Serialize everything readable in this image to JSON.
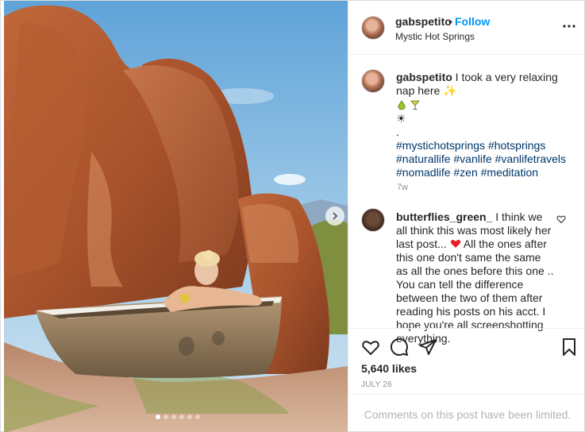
{
  "post": {
    "username": "gabspetito",
    "bullet": "•",
    "follow_label": "Follow",
    "location": "Mystic Hot Springs",
    "more_icon": "more-options-icon"
  },
  "photo": {
    "carousel_total": 6,
    "carousel_active": 1,
    "next_icon": "chevron-right-icon"
  },
  "caption": {
    "username": "gabspetito",
    "text": "I took a very relaxing nap here",
    "sparkle": "✨",
    "sun": "☀",
    "dot": ".",
    "hashtags_line1": "#mysticho tsprings #hotsprings",
    "hashtags": [
      "#mystichotsprings",
      "#hotsprings",
      "#naturallife",
      "#vanlife",
      "#vanlifetravels",
      "#nomadlife",
      "#zen",
      "#meditation"
    ],
    "time": "7w"
  },
  "comment": {
    "username": "butterflies_green_",
    "text_before_heart": "I think we all think this was most likely her last post...",
    "text_after_heart": "All the ones after this one don't same the same as all the ones before this one .. You can tell the difference between the two of them after reading his posts on his acct. I hope you're all screenshotting everything."
  },
  "actions": {
    "likes": "5,640 likes",
    "date": "JULY 26",
    "limited": "Comments on this post have been limited."
  },
  "colors": {
    "accent": "#0095f6",
    "hashtag": "#00376b",
    "muted": "#8e8e8e",
    "heart_red": "#ed1c24"
  }
}
